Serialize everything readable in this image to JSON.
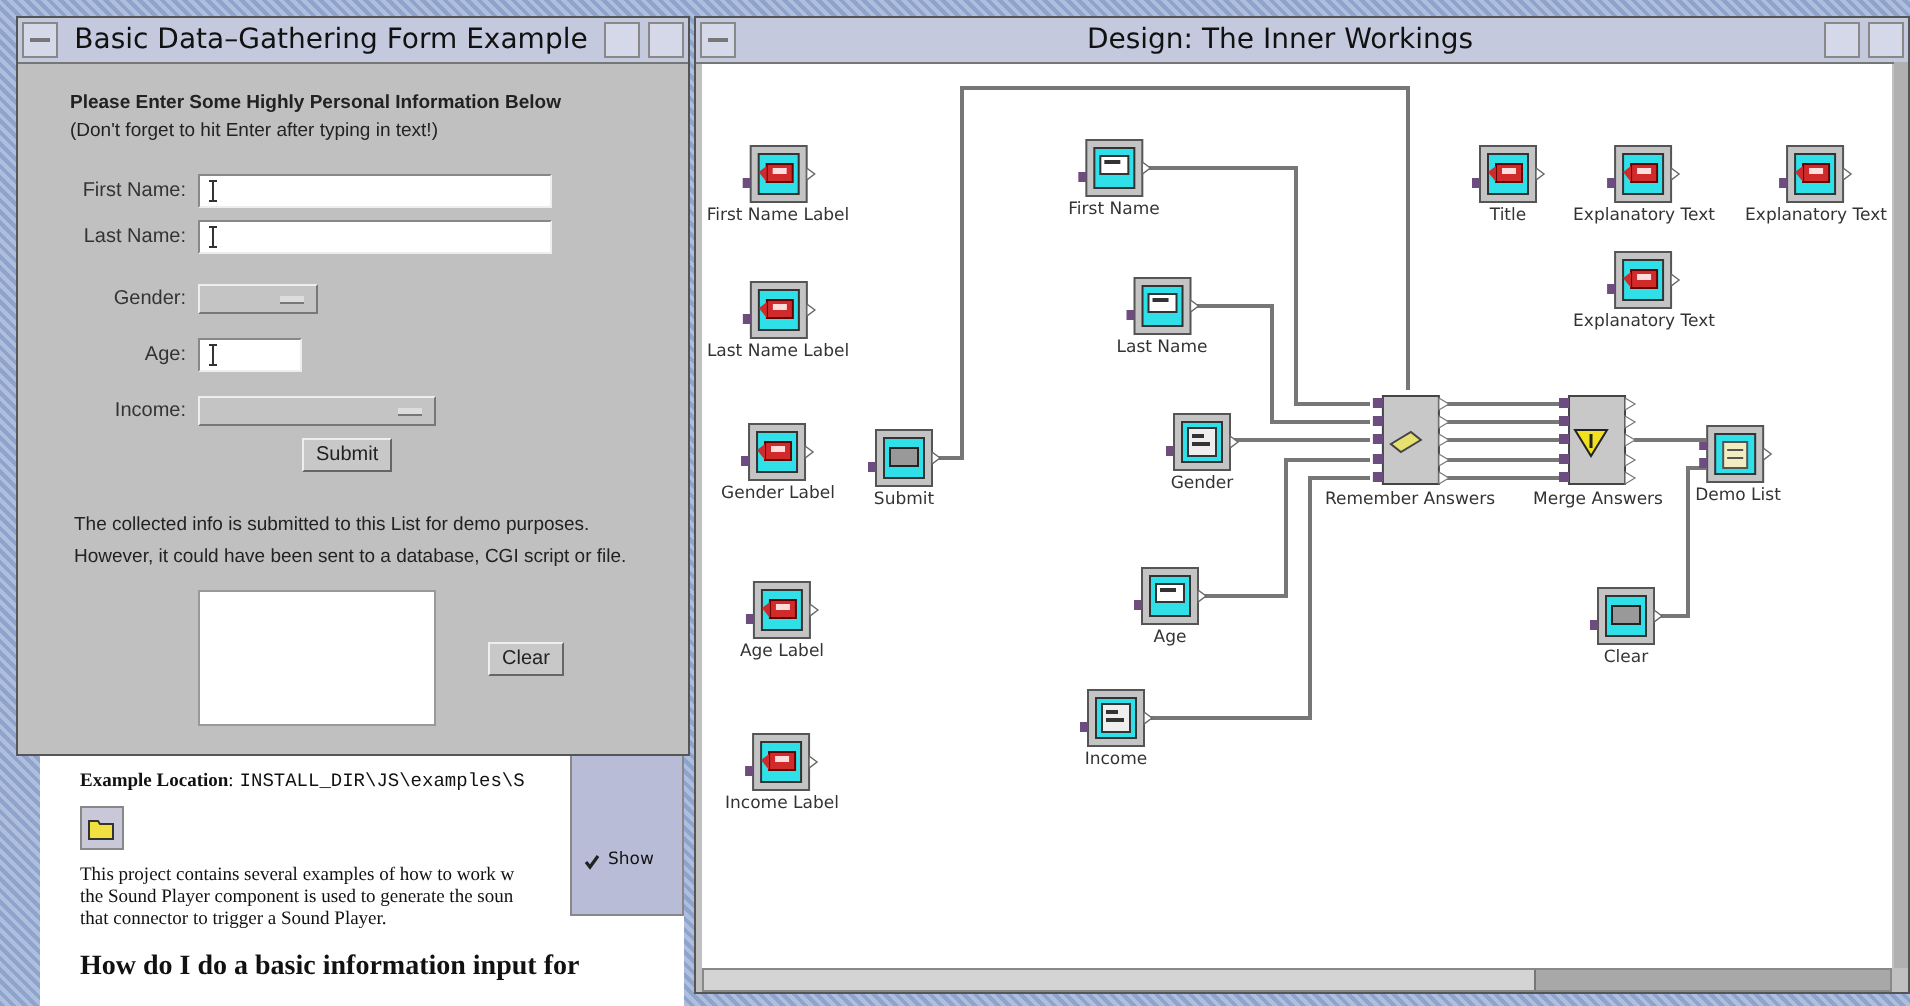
{
  "form_window": {
    "title": "Basic Data–Gathering Form Example",
    "heading": "Please Enter Some Highly Personal Information Below",
    "note": "(Don't forget to hit Enter after typing in text!)",
    "fields": [
      {
        "kind": "text",
        "label": "First Name:"
      },
      {
        "kind": "text",
        "label": "Last Name:"
      },
      {
        "kind": "choice",
        "label": "Gender:"
      },
      {
        "kind": "short",
        "label": "Age:"
      },
      {
        "kind": "choice_wide",
        "label": "Income:"
      }
    ],
    "submit": "Submit",
    "info": [
      "The collected info is submitted to this List for demo purposes.",
      "However, it could have been sent to a database, CGI script or file."
    ],
    "clear": "Clear"
  },
  "help_page": {
    "location_label": "**Example Location**:",
    "location_path": "INSTALL_DIR\\JS\\examples\\S",
    "paragraph": [
      "This project contains several examples of how to work w",
      "the Sound Player component is used to generate the soun",
      "that connector to trigger a Sound Player."
    ],
    "heading": "How do I do a basic information input for",
    "show": {
      "label": "Show",
      "checked": true
    }
  },
  "design_window": {
    "title": "Design: The Inner Workings",
    "nodes": [
      {
        "name": "First Name Label",
        "kind": "label"
      },
      {
        "name": "Last Name Label",
        "kind": "label"
      },
      {
        "name": "Gender Label",
        "kind": "label"
      },
      {
        "name": "Age Label",
        "kind": "label"
      },
      {
        "name": "Income Label",
        "kind": "label"
      },
      {
        "name": "Submit",
        "kind": "button"
      },
      {
        "name": "First Name",
        "kind": "textfield"
      },
      {
        "name": "Last Name",
        "kind": "textfield"
      },
      {
        "name": "Gender",
        "kind": "choice"
      },
      {
        "name": "Age",
        "kind": "textfield"
      },
      {
        "name": "Income",
        "kind": "choice"
      },
      {
        "name": "Remember Answers",
        "kind": "store"
      },
      {
        "name": "Merge Answers",
        "kind": "merge"
      },
      {
        "name": "Demo List",
        "kind": "list"
      },
      {
        "name": "Clear",
        "kind": "button"
      },
      {
        "name": "Title",
        "kind": "label"
      },
      {
        "name": "Explanatory Text",
        "kind": "label"
      },
      {
        "name": "Explanatory Text",
        "kind": "label"
      },
      {
        "name": "Explanatory Text",
        "kind": "label"
      }
    ]
  }
}
